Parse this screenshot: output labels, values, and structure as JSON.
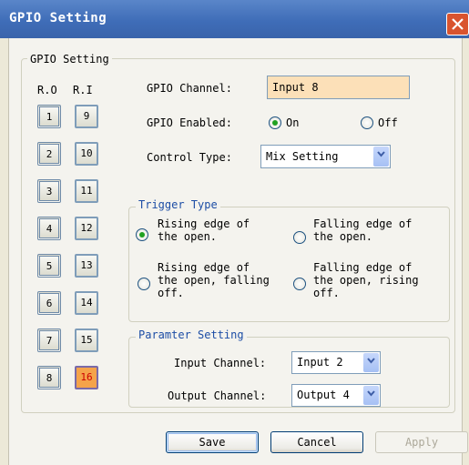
{
  "window": {
    "title": "GPIO Setting"
  },
  "group_main": {
    "label": "GPIO Setting"
  },
  "columns": {
    "ro": "R.O",
    "ri": "R.I"
  },
  "ro_buttons": [
    "1",
    "2",
    "3",
    "4",
    "5",
    "6",
    "7",
    "8"
  ],
  "ri_buttons": [
    "9",
    "10",
    "11",
    "12",
    "13",
    "14",
    "15",
    "16"
  ],
  "active_button": "16",
  "channel": {
    "label": "GPIO Channel:",
    "value": "Input 8"
  },
  "enabled": {
    "label": "GPIO Enabled:",
    "on": "On",
    "off": "Off",
    "selected": "On"
  },
  "control": {
    "label": "Control Type:",
    "value": "Mix Setting"
  },
  "trigger": {
    "label": "Trigger Type",
    "options": [
      {
        "line1": "Rising edge of",
        "line2": "the open.",
        "line3": ""
      },
      {
        "line1": "Falling edge of",
        "line2": "the open.",
        "line3": ""
      },
      {
        "line1": "Rising edge of",
        "line2": "the open, falling",
        "line3": "off."
      },
      {
        "line1": "Falling edge of",
        "line2": "the open, rising",
        "line3": "off."
      }
    ],
    "selected_index": 0
  },
  "param": {
    "label": "Paramter Setting",
    "input_label": "Input Channel:",
    "input_value": "Input 2",
    "output_label": "Output Channel:",
    "output_value": "Output 4"
  },
  "buttons": {
    "save": "Save",
    "cancel": "Cancel",
    "apply": "Apply"
  },
  "colors": {
    "titlebar": "#3f6db8",
    "channel_bg": "#fce0b8",
    "active_button": "#f5a34a",
    "radio_dot": "#21a121"
  }
}
